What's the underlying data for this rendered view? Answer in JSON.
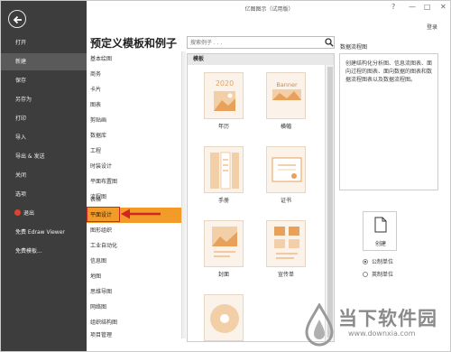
{
  "window": {
    "title": "亿图图示（试用版）",
    "help_glyph": "?",
    "min_glyph": "—",
    "max_glyph": "□",
    "close_glyph": "✕",
    "login_label": "登录"
  },
  "sidebar": {
    "items": [
      {
        "label": "打开"
      },
      {
        "label": "新建",
        "active": true
      },
      {
        "label": "保存"
      },
      {
        "label": "另存为"
      },
      {
        "label": "打印"
      },
      {
        "label": "导入"
      },
      {
        "label": "导出 & 发送"
      },
      {
        "label": "关闭"
      },
      {
        "label": "选项"
      },
      {
        "label": "退出",
        "icon": "exit-icon"
      },
      {
        "label": "免费 Edraw Viewer"
      },
      {
        "label": "免费模板..."
      }
    ]
  },
  "categories": {
    "title": "预定义模板和例子",
    "items": [
      "基本绘图",
      "商务",
      "卡片",
      "图表",
      "剪贴画",
      "数据库",
      "工程",
      "时装设计",
      "平面布置图",
      "流程图",
      "表格",
      "平面设计",
      "图形组织",
      "工业自动化",
      "信息图",
      "地图",
      "思维导图",
      "网络图",
      "组织结构图",
      "项目管理"
    ],
    "selected": "平面设计"
  },
  "search": {
    "placeholder": "搜索例子 . . ."
  },
  "templates": {
    "header": "模板",
    "items": [
      {
        "label": "年历",
        "thumb_text": "2020",
        "icon": "calendar-thumb-icon"
      },
      {
        "label": "横幅",
        "thumb_text": "Banner",
        "icon": "banner-thumb-icon"
      },
      {
        "label": "手册",
        "icon": "brochure-thumb-icon"
      },
      {
        "label": "证书",
        "icon": "certificate-thumb-icon"
      },
      {
        "label": "封面",
        "icon": "cover-thumb-icon"
      },
      {
        "label": "宣传单",
        "icon": "flyer-thumb-icon"
      },
      {
        "label": "",
        "icon": "cd-thumb-icon"
      }
    ]
  },
  "description": {
    "title": "数据流程图",
    "text": "创建结构化分析图、信息流图表、面向过程的图表、面向数据的图表和数据流程图表以及数据流程图。"
  },
  "create": {
    "label": "创建"
  },
  "units": {
    "metric": "公制单位",
    "imperial": "英制单位",
    "selected": "metric"
  },
  "watermark": {
    "cn": "当下软件园",
    "en": "www.downxia.com"
  },
  "colors": {
    "accent": "#f39b28",
    "sidebar": "#3d3d3d",
    "highlight": "#d32424",
    "thumb_orange": "#e8a15a"
  }
}
